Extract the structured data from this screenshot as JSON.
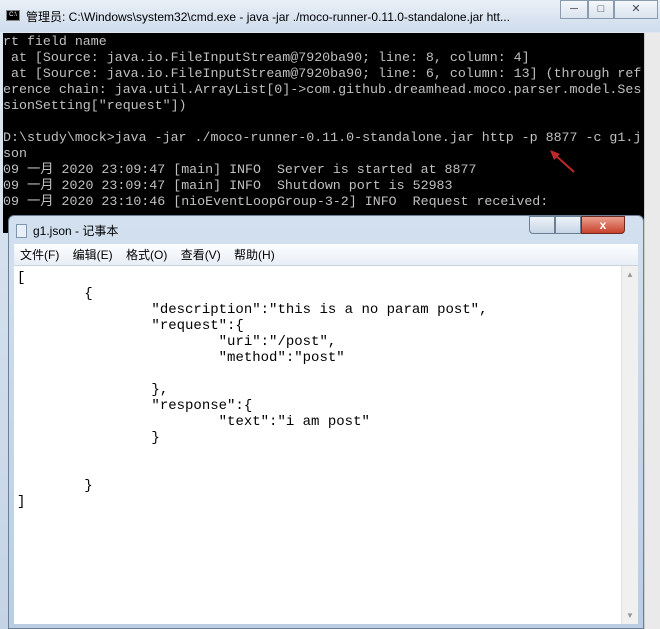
{
  "cmd": {
    "title": "管理员: C:\\Windows\\system32\\cmd.exe - java  -jar ./moco-runner-0.11.0-standalone.jar htt...",
    "icon_label": "C:\\",
    "output": "rt field name\n at [Source: java.io.FileInputStream@7920ba90; line: 8, column: 4]\n at [Source: java.io.FileInputStream@7920ba90; line: 6, column: 13] (through ref\nerence chain: java.util.ArrayList[0]->com.github.dreamhead.moco.parser.model.Ses\nsionSetting[\"request\"])\n\nD:\\study\\mock>java -jar ./moco-runner-0.11.0-standalone.jar http -p 8877 -c g1.j\nson\n09 一月 2020 23:09:47 [main] INFO  Server is started at 8877\n09 一月 2020 23:09:47 [main] INFO  Shutdown port is 52983\n09 一月 2020 23:10:46 [nioEventLoopGroup-3-2] INFO  Request received:"
  },
  "notepad": {
    "title": "g1.json - 记事本",
    "menu": [
      "文件(F)",
      "编辑(E)",
      "格式(O)",
      "查看(V)",
      "帮助(H)"
    ],
    "content": "[\n\t{\n\t\t\"description\":\"this is a no param post\",\n\t\t\"request\":{\n\t\t\t\"uri\":\"/post\",\n\t\t\t\"method\":\"post\"\n\n\t\t},\n\t\t\"response\":{\n\t\t\t\"text\":\"i am post\"\n\t\t}\n\n\n\t}\n]"
  },
  "colors": {
    "annotation_arrow": "#c0282a",
    "console_bg": "#000000",
    "console_text": "#c0c0c0"
  }
}
